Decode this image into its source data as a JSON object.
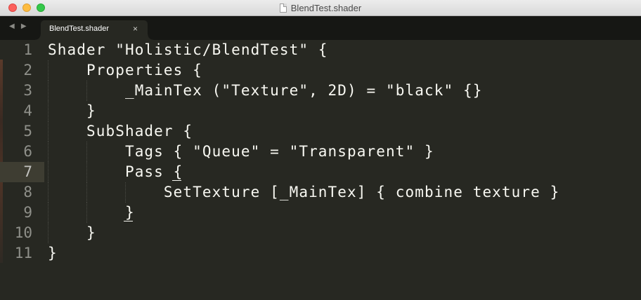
{
  "window": {
    "title": "BlendTest.shader"
  },
  "tabbar": {
    "nav_arrows": "◀ ▶",
    "active_tab": {
      "label": "BlendTest.shader",
      "close_glyph": "×"
    }
  },
  "editor": {
    "current_line": 7,
    "lines": [
      {
        "number": "1",
        "text": "Shader \"Holistic/BlendTest\" {"
      },
      {
        "number": "2",
        "text": "    Properties {"
      },
      {
        "number": "3",
        "text": "        _MainTex (\"Texture\", 2D) = \"black\" {}"
      },
      {
        "number": "4",
        "text": "    }"
      },
      {
        "number": "5",
        "text": "    SubShader {"
      },
      {
        "number": "6",
        "text": "        Tags { \"Queue\" = \"Transparent\" }"
      },
      {
        "number": "7",
        "text": "        Pass {"
      },
      {
        "number": "8",
        "text": "            SetTexture [_MainTex] { combine texture }"
      },
      {
        "number": "9",
        "text": "        }"
      },
      {
        "number": "10",
        "text": "    }"
      },
      {
        "number": "11",
        "text": "}"
      }
    ]
  },
  "colors": {
    "editor_background": "#272822",
    "tabbar_background": "#161714",
    "foreground": "#f8f8f2",
    "gutter_foreground": "#8f908a",
    "current_line_highlight": "#3e3d32"
  }
}
